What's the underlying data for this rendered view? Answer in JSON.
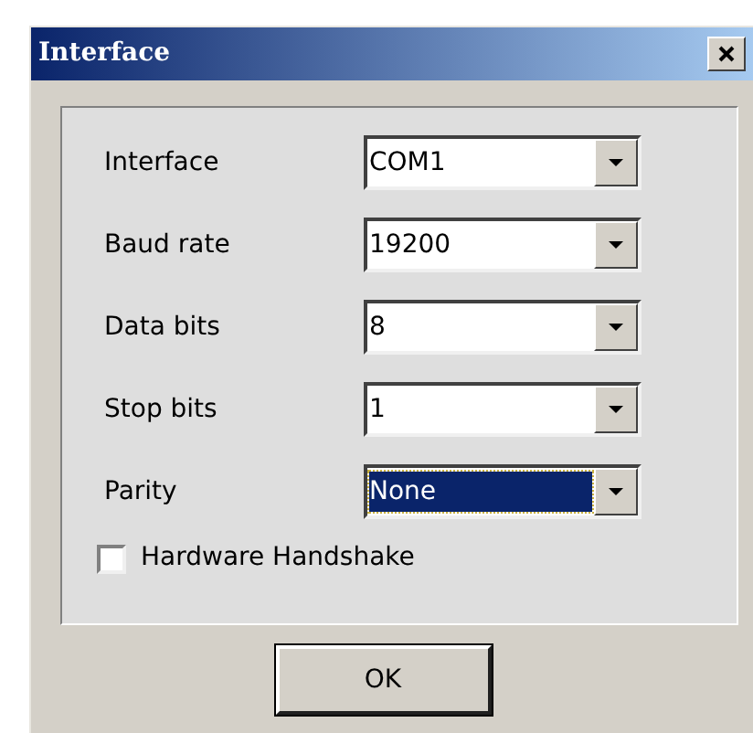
{
  "window": {
    "title": "Interface"
  },
  "fields": [
    {
      "label": "Interface",
      "value": "COM1",
      "selected": false
    },
    {
      "label": "Baud rate",
      "value": "19200",
      "selected": false
    },
    {
      "label": "Data bits",
      "value": "8",
      "selected": false
    },
    {
      "label": "Stop bits",
      "value": "1",
      "selected": false
    },
    {
      "label": "Parity",
      "value": "None",
      "selected": true
    }
  ],
  "checkbox": {
    "label": "Hardware Handshake",
    "checked": false
  },
  "buttons": [
    "OK"
  ]
}
